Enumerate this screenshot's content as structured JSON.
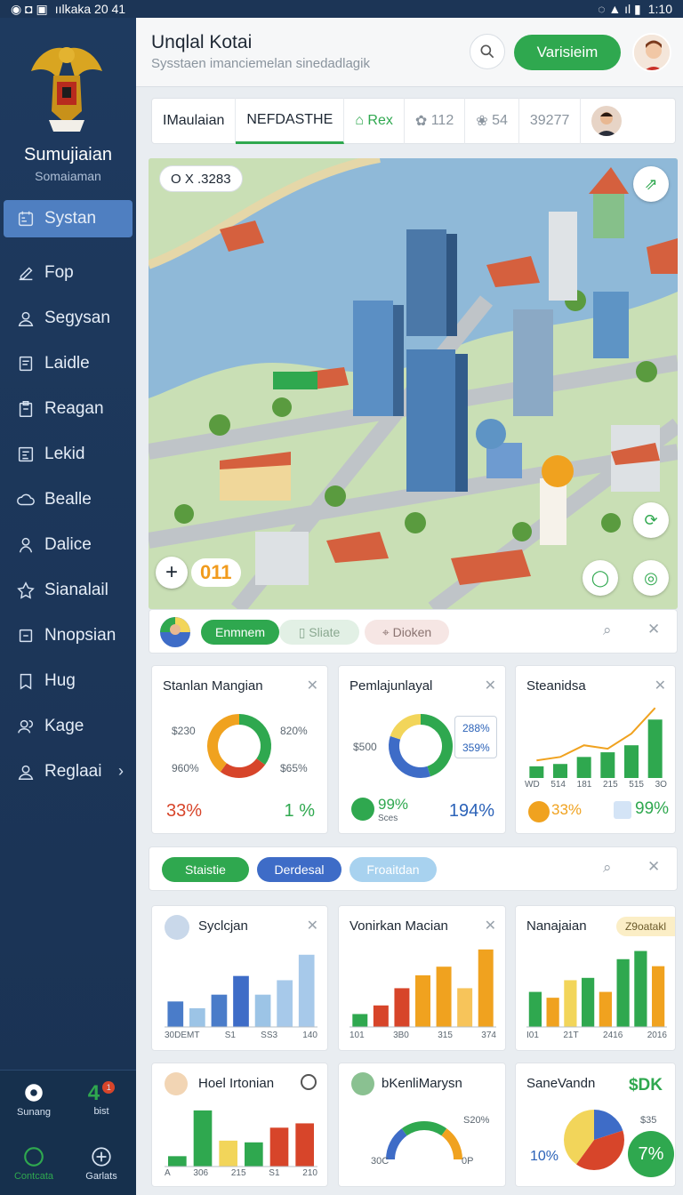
{
  "status_bar": {
    "left_text": "ıılkaka 20 41",
    "time": "1:10"
  },
  "sidebar": {
    "brand": "Sumujiaian",
    "brand_sub": "Somaiaman",
    "items": [
      {
        "label": "Systan",
        "icon": "calendar-icon",
        "active": true
      },
      {
        "label": "Fop",
        "icon": "edit-icon"
      },
      {
        "label": "Segysan",
        "icon": "user-icon"
      },
      {
        "label": "Laidle",
        "icon": "document-icon"
      },
      {
        "label": "Reagan",
        "icon": "clipboard-icon"
      },
      {
        "label": "Lekid",
        "icon": "list-icon"
      },
      {
        "label": "Bealle",
        "icon": "cloud-icon"
      },
      {
        "label": "Dalice",
        "icon": "person-icon"
      },
      {
        "label": "Sianalail",
        "icon": "star-icon"
      },
      {
        "label": "Nnopsian",
        "icon": "square-icon"
      },
      {
        "label": "Hug",
        "icon": "bookmark-icon"
      },
      {
        "label": "Kage",
        "icon": "users-icon"
      },
      {
        "label": "Reglaai",
        "icon": "account-icon"
      }
    ],
    "bottom": {
      "settings_label": "Sunang",
      "count": "4",
      "badge": "1",
      "count_label": "bist",
      "left2_label": "Contcata",
      "right2_label": "Garlats"
    }
  },
  "header": {
    "title": "Unqlal Kotai",
    "subtitle": "Sysstaen imanciemelan sinedadlagik",
    "primary_button": "Varisieim"
  },
  "tabs": [
    {
      "label": "IMaulaian"
    },
    {
      "label": "NEFDASTHE",
      "active": true
    },
    {
      "label": "Rex"
    },
    {
      "label": "112"
    },
    {
      "label": "54"
    },
    {
      "label": "39277"
    }
  ],
  "map": {
    "coord": "O X .3283",
    "zoom": "011"
  },
  "filter1": {
    "chips": [
      "Enmnem",
      "Sliate",
      "Dioken"
    ]
  },
  "filter2": {
    "chips": [
      "Staistie",
      "Derdesal",
      "Froaitdan"
    ]
  },
  "cards_row1": [
    {
      "title": "Stanlan Mangian",
      "labels": [
        "$230",
        "820%",
        "960%",
        "$65%"
      ],
      "left_value": "33%",
      "right_value": "1 %",
      "chart_data": {
        "type": "pie",
        "values": [
          35,
          25,
          40
        ],
        "colors": [
          "#2fa84f",
          "#d7452a",
          "#f0a21f"
        ]
      }
    },
    {
      "title": "Pemlajunlayal",
      "labels": [
        "$500",
        "288%",
        "359%"
      ],
      "left_value": "99%",
      "left_sub": "Sces",
      "right_value": "194%",
      "chart_data": {
        "type": "pie",
        "values": [
          45,
          35,
          20
        ],
        "colors": [
          "#2fa84f",
          "#3e6cc7",
          "#f2d55a"
        ]
      }
    },
    {
      "title": "Steanidsa",
      "left_value": "33%",
      "right_value": "99%",
      "chart_data": {
        "type": "bar",
        "categories": [
          "WD",
          "514",
          "181",
          "215",
          "515",
          "3O"
        ],
        "values": [
          10,
          12,
          18,
          22,
          28,
          50
        ],
        "line": [
          15,
          18,
          28,
          25,
          38,
          60
        ]
      }
    }
  ],
  "cards_row2": [
    {
      "title": "Syclcjan",
      "ticks": [
        "30DEMT",
        "S1",
        "SS3",
        "140"
      ],
      "chart_data": {
        "type": "bar",
        "values": [
          30,
          22,
          38,
          60,
          38,
          55,
          85
        ],
        "colors": [
          "#4a7cc9",
          "#9cc4e6",
          "#4a7cc9",
          "#3e6cc7",
          "#9cc4e6",
          "#a7c9ea",
          "#a7c9ea"
        ]
      }
    },
    {
      "title": "Vonirkan Macian",
      "ticks": [
        "101",
        "3B0",
        "315",
        "374"
      ],
      "chart_data": {
        "type": "bar",
        "values": [
          15,
          25,
          45,
          60,
          70,
          45,
          90
        ],
        "colors": [
          "#2fa84f",
          "#d7452a",
          "#d7452a",
          "#f0a21f",
          "#f0a21f",
          "#f7c45a",
          "#f0a21f"
        ]
      }
    },
    {
      "title": "Nanajaian",
      "badge": "Z9oatakl",
      "ticks": [
        "I01",
        "21T",
        "2416",
        "2016"
      ],
      "chart_data": {
        "type": "bar",
        "values": [
          30,
          25,
          40,
          42,
          30,
          58,
          65,
          52
        ],
        "colors": [
          "#2fa84f",
          "#f0a21f",
          "#f2d55a",
          "#2fa84f",
          "#f0a21f",
          "#2fa84f",
          "#2fa84f",
          "#f0a21f"
        ]
      }
    }
  ],
  "cards_row3": [
    {
      "title": "Hoel Irtonian",
      "ticks": [
        "A",
        "306",
        "215",
        "S1",
        "210"
      ],
      "chart_data": {
        "type": "bar",
        "values": [
          12,
          65,
          30,
          28,
          45,
          50
        ],
        "colors": [
          "#2fa84f",
          "#2fa84f",
          "#f2d55a",
          "#2fa84f",
          "#d7452a",
          "#d7452a"
        ]
      }
    },
    {
      "title": "bKenliMarysn",
      "labels": [
        "30C",
        "0P",
        "S20%"
      ],
      "chart_data": {
        "type": "pie",
        "values": [
          30,
          40,
          30
        ],
        "colors": [
          "#3e6cc7",
          "#2fa84f",
          "#f0a21f"
        ]
      }
    },
    {
      "title": "SaneVandn",
      "value": "$DK",
      "labels": [
        "10%",
        "$35"
      ],
      "badge": "7%",
      "chart_data": {
        "type": "pie",
        "values": [
          20,
          40,
          40
        ],
        "colors": [
          "#3e6cc7",
          "#d7452a",
          "#f2d55a"
        ]
      }
    }
  ]
}
